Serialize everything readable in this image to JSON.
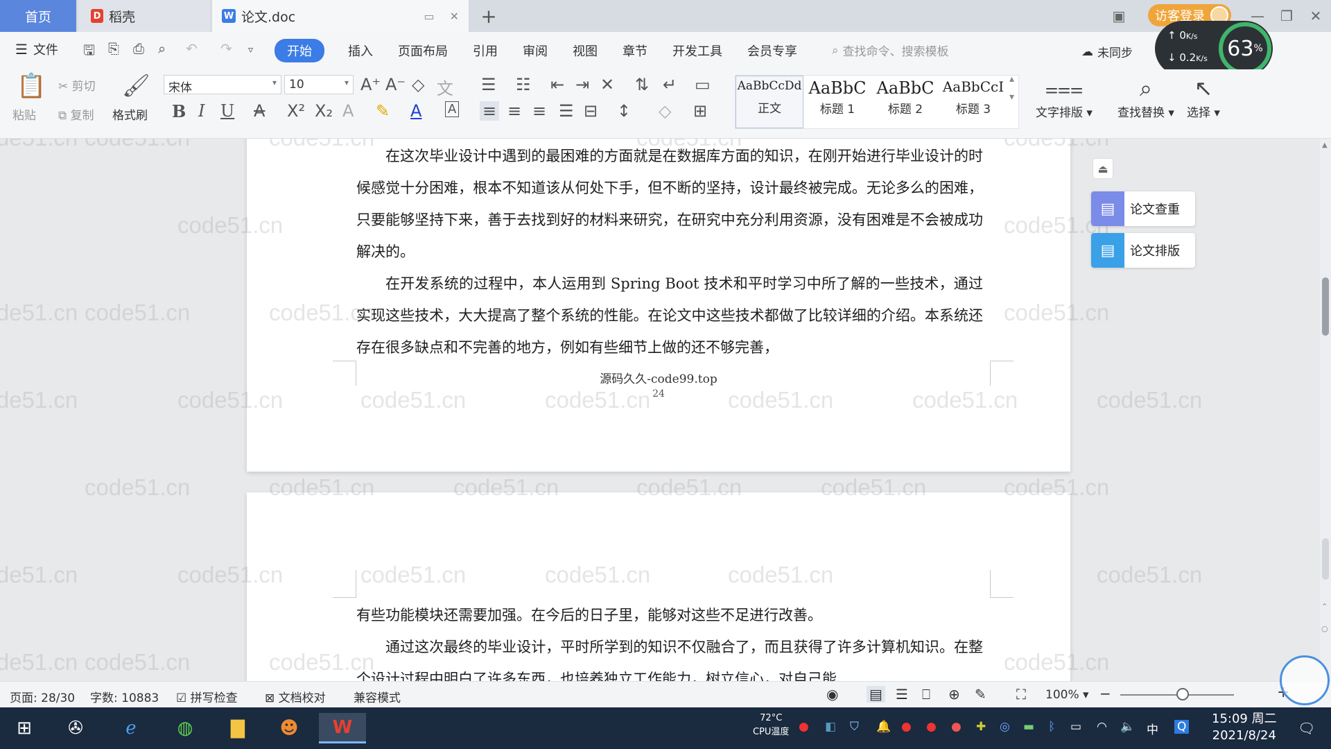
{
  "tabs": {
    "home": "首页",
    "daoke": "稻壳",
    "doc": "论文.doc"
  },
  "login": "访客登录",
  "menu": {
    "file": "文件",
    "tabs": [
      "开始",
      "插入",
      "页面布局",
      "引用",
      "审阅",
      "视图",
      "章节",
      "开发工具",
      "会员专享"
    ],
    "search": "查找命令、搜索模板",
    "sync": "未同步"
  },
  "speed": {
    "up": "0",
    "up_unit": "K/s",
    "down": "0.2",
    "down_unit": "K/s",
    "percent": "63",
    "percent_unit": "%"
  },
  "toolbar": {
    "paste": "粘贴",
    "cut": "剪切",
    "copy": "复制",
    "format_painter": "格式刷",
    "font_name": "宋体",
    "font_size": "10",
    "styles": [
      {
        "sample": "AaBbCcDd",
        "name": "正文"
      },
      {
        "sample": "AaBbC",
        "name": "标题 1"
      },
      {
        "sample": "AaBbC",
        "name": "标题 2"
      },
      {
        "sample": "AaBbCcI",
        "name": "标题 3"
      }
    ],
    "text_layout": "文字排版",
    "find_replace": "查找替换",
    "select": "选择"
  },
  "side": {
    "check": "论文查重",
    "layout": "论文排版"
  },
  "document": {
    "page1_paragraphs": [
      "在这次毕业设计中遇到的最困难的方面就是在数据库方面的知识，在刚开始进行毕业设计的时候感觉十分困难，根本不知道该从何处下手，但不断的坚持，设计最终被完成。无论多么的困难，只要能够坚持下来，善于去找到好的材料来研究，在研究中充分利用资源，没有困难是不会被成功解决的。",
      "在开发系统的过程中，本人运用到 Spring Boot 技术和平时学习中所了解的一些技术，通过实现这些技术，大大提高了整个系统的性能。在论文中这些技术都做了比较详细的介绍。本系统还存在很多缺点和不完善的地方，例如有些细节上做的还不够完善，"
    ],
    "footer": "源码久久-code99.top",
    "page_number": "24",
    "page2_paragraphs": [
      "有些功能模块还需要加强。在今后的日子里，能够对这些不足进行改善。",
      "通过这次最终的毕业设计，平时所学到的知识不仅融合了，而且获得了许多计算机知识。在整个设计过程中明白了许多东西，也培养独立工作能力，树立信心，对自己能"
    ],
    "watermark": "code51.cn"
  },
  "status": {
    "page": "页面: 28/30",
    "words": "字数: 10883",
    "spell": "拼写检查",
    "proofread": "文档校对",
    "compat": "兼容模式",
    "zoom": "100%",
    "zoom_level": 0.55
  },
  "taskbar": {
    "temp": "72°C",
    "temp_label": "CPU温度",
    "ime": "中",
    "time": "15:09 周二",
    "date": "2021/8/24"
  },
  "colors": {
    "accent": "#3b7ce6",
    "home_tab": "#5b86dd",
    "login": "#f0a53a",
    "taskbar": "#1a2a3f"
  }
}
